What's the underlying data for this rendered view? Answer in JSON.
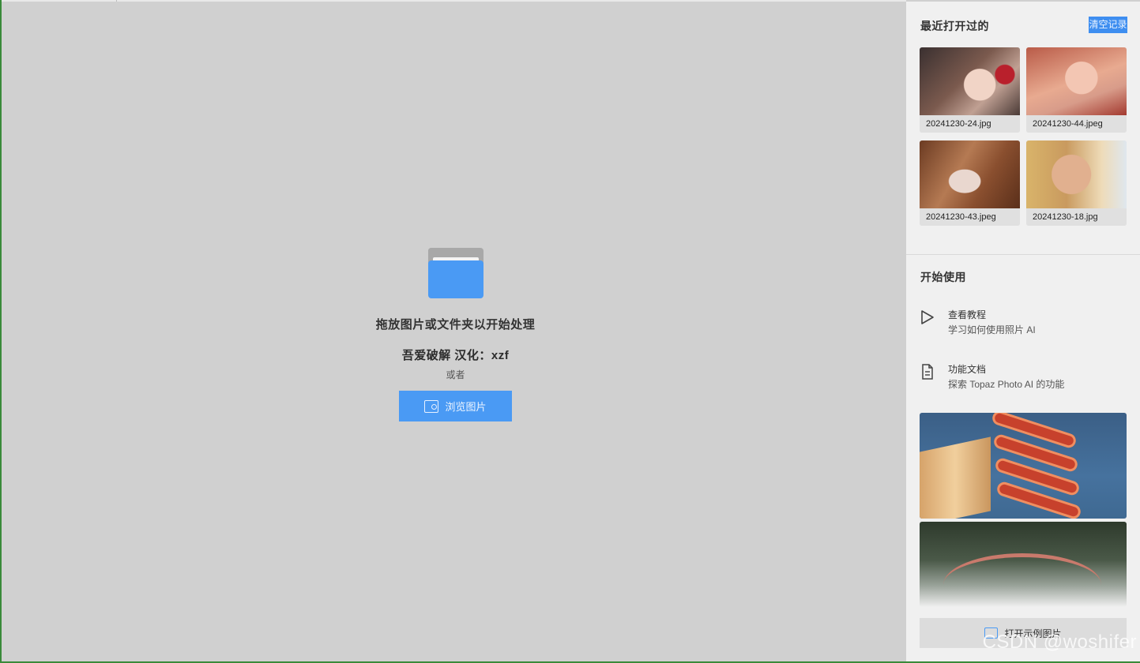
{
  "main": {
    "drop_title": "拖放图片或文件夹以开始处理",
    "credit": "吾爱破解  汉化：xzf",
    "or_text": "或者",
    "browse_button": "浏览图片"
  },
  "sidebar": {
    "recent_title": "最近打开过的",
    "clear_link": "清空记录",
    "recent_files": [
      {
        "name": "20241230-24.jpg"
      },
      {
        "name": "20241230-44.jpeg"
      },
      {
        "name": "20241230-43.jpeg"
      },
      {
        "name": "20241230-18.jpg"
      }
    ],
    "start_title": "开始使用",
    "links": [
      {
        "title": "查看教程",
        "subtitle": "学习如何使用照片 AI",
        "icon": "play-icon"
      },
      {
        "title": "功能文档",
        "subtitle": "探索 Topaz Photo AI 的功能",
        "icon": "document-icon"
      }
    ],
    "open_sample_button": "打开示例图片"
  },
  "watermark": "CSDN @woshifer",
  "colors": {
    "accent": "#4a9af4",
    "background": "#d0d0d0",
    "sidebar": "#f0f0f0"
  }
}
